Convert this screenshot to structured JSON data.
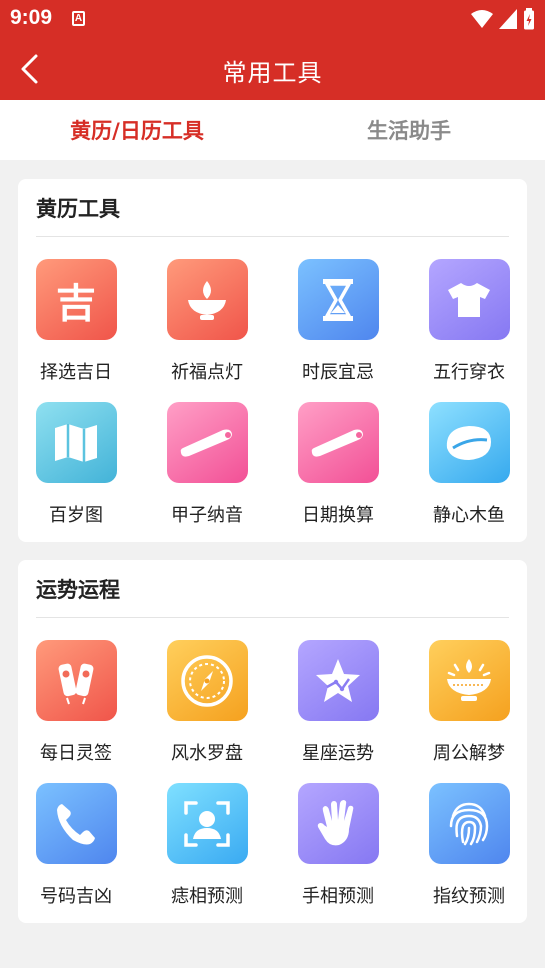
{
  "status_bar": {
    "time": "9:09",
    "notification_icon_letter": "A"
  },
  "header": {
    "title": "常用工具"
  },
  "tabs": [
    {
      "label": "黄历/日历工具",
      "active": true
    },
    {
      "label": "生活助手",
      "active": false
    }
  ],
  "sections": [
    {
      "title": "黄历工具",
      "items": [
        {
          "label": "择选吉日",
          "icon": "ji-character-icon",
          "glyph": "吉"
        },
        {
          "label": "祈福点灯",
          "icon": "oil-lamp-icon"
        },
        {
          "label": "时辰宜忌",
          "icon": "hourglass-icon"
        },
        {
          "label": "五行穿衣",
          "icon": "tshirt-icon"
        },
        {
          "label": "百岁图",
          "icon": "map-icon"
        },
        {
          "label": "甲子纳音",
          "icon": "scroll-icon"
        },
        {
          "label": "日期换算",
          "icon": "scroll-icon"
        },
        {
          "label": "静心木鱼",
          "icon": "wooden-fish-icon"
        }
      ]
    },
    {
      "title": "运势运程",
      "items": [
        {
          "label": "每日灵签",
          "icon": "fortune-sticks-icon"
        },
        {
          "label": "风水罗盘",
          "icon": "compass-icon"
        },
        {
          "label": "星座运势",
          "icon": "star-constellation-icon"
        },
        {
          "label": "周公解梦",
          "icon": "dream-lamp-icon"
        },
        {
          "label": "号码吉凶",
          "icon": "phone-icon"
        },
        {
          "label": "痣相预测",
          "icon": "face-scan-icon"
        },
        {
          "label": "手相预测",
          "icon": "palm-icon"
        },
        {
          "label": "指纹预测",
          "icon": "fingerprint-icon"
        }
      ]
    }
  ],
  "colors": {
    "primary": "#d62e26",
    "background": "#f1f1f1"
  }
}
